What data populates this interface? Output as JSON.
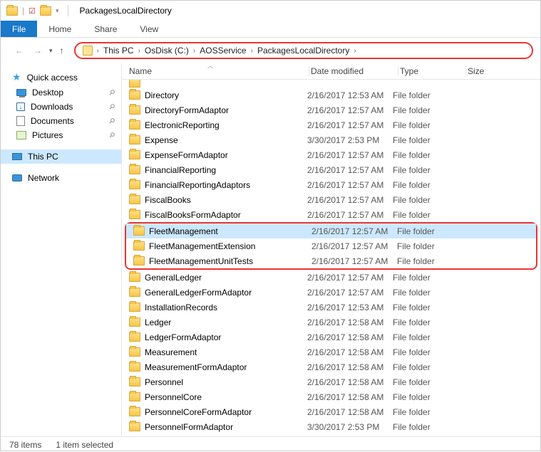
{
  "title": "PackagesLocalDirectory",
  "menu": {
    "file": "File",
    "home": "Home",
    "share": "Share",
    "view": "View"
  },
  "breadcrumb": [
    "This PC",
    "OsDisk (C:)",
    "AOSService",
    "PackagesLocalDirectory"
  ],
  "sidebar": {
    "quick": "Quick access",
    "desktop": "Desktop",
    "downloads": "Downloads",
    "documents": "Documents",
    "pictures": "Pictures",
    "thispc": "This PC",
    "network": "Network"
  },
  "columns": {
    "name": "Name",
    "date": "Date modified",
    "type": "Type",
    "size": "Size"
  },
  "rows": [
    {
      "name": "Directory",
      "date": "2/16/2017 12:53 AM",
      "type": "File folder"
    },
    {
      "name": "DirectoryFormAdaptor",
      "date": "2/16/2017 12:57 AM",
      "type": "File folder"
    },
    {
      "name": "ElectronicReporting",
      "date": "2/16/2017 12:57 AM",
      "type": "File folder"
    },
    {
      "name": "Expense",
      "date": "3/30/2017 2:53 PM",
      "type": "File folder"
    },
    {
      "name": "ExpenseFormAdaptor",
      "date": "2/16/2017 12:57 AM",
      "type": "File folder"
    },
    {
      "name": "FinancialReporting",
      "date": "2/16/2017 12:57 AM",
      "type": "File folder"
    },
    {
      "name": "FinancialReportingAdaptors",
      "date": "2/16/2017 12:57 AM",
      "type": "File folder"
    },
    {
      "name": "FiscalBooks",
      "date": "2/16/2017 12:57 AM",
      "type": "File folder"
    },
    {
      "name": "FiscalBooksFormAdaptor",
      "date": "2/16/2017 12:57 AM",
      "type": "File folder"
    },
    {
      "name": "FleetManagement",
      "date": "2/16/2017 12:57 AM",
      "type": "File folder",
      "selected": true,
      "hl": true
    },
    {
      "name": "FleetManagementExtension",
      "date": "2/16/2017 12:57 AM",
      "type": "File folder",
      "hl": true
    },
    {
      "name": "FleetManagementUnitTests",
      "date": "2/16/2017 12:57 AM",
      "type": "File folder",
      "hl": true
    },
    {
      "name": "GeneralLedger",
      "date": "2/16/2017 12:57 AM",
      "type": "File folder"
    },
    {
      "name": "GeneralLedgerFormAdaptor",
      "date": "2/16/2017 12:57 AM",
      "type": "File folder"
    },
    {
      "name": "InstallationRecords",
      "date": "2/16/2017 12:53 AM",
      "type": "File folder"
    },
    {
      "name": "Ledger",
      "date": "2/16/2017 12:58 AM",
      "type": "File folder"
    },
    {
      "name": "LedgerFormAdaptor",
      "date": "2/16/2017 12:58 AM",
      "type": "File folder"
    },
    {
      "name": "Measurement",
      "date": "2/16/2017 12:58 AM",
      "type": "File folder"
    },
    {
      "name": "MeasurementFormAdaptor",
      "date": "2/16/2017 12:58 AM",
      "type": "File folder"
    },
    {
      "name": "Personnel",
      "date": "2/16/2017 12:58 AM",
      "type": "File folder"
    },
    {
      "name": "PersonnelCore",
      "date": "2/16/2017 12:58 AM",
      "type": "File folder"
    },
    {
      "name": "PersonnelCoreFormAdaptor",
      "date": "2/16/2017 12:58 AM",
      "type": "File folder"
    },
    {
      "name": "PersonnelFormAdaptor",
      "date": "3/30/2017 2:53 PM",
      "type": "File folder"
    }
  ],
  "status": {
    "items": "78 items",
    "selected": "1 item selected"
  }
}
